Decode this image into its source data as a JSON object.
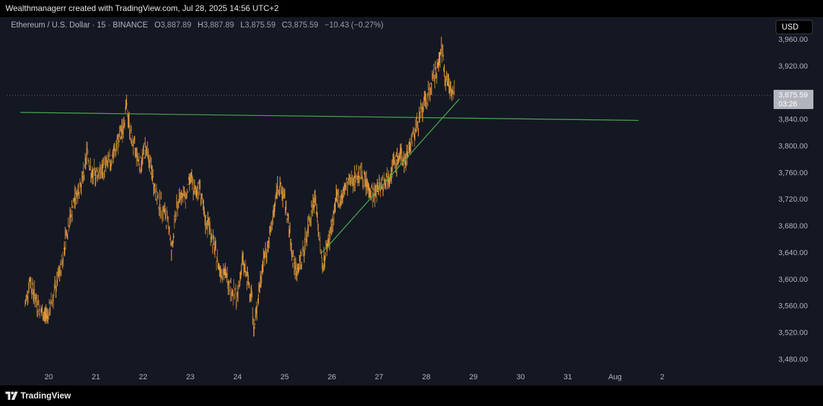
{
  "header": {
    "text": "Wealthmanagerr created with TradingView.com, Jul 28, 2025 14:56 UTC+2"
  },
  "legend": {
    "symbol": "Ethereum / U.S. Dollar · 15 · BINANCE",
    "open_label": "O",
    "open": "3,887.89",
    "high_label": "H",
    "high": "3,887.89",
    "low_label": "L",
    "low": "3,875.59",
    "close_label": "C",
    "close": "3,875.59",
    "change": "−10.43 (−0.27%)"
  },
  "currency_button": "USD",
  "price_tag": {
    "price": "3,875.59",
    "countdown": "03:26"
  },
  "footer": {
    "logo_text": "TradingView"
  },
  "colors": {
    "background": "#141823",
    "candles": "#f0a23c",
    "trendline": "#4caf50",
    "price_tag": "#b2b5be"
  },
  "chart_data": {
    "type": "line",
    "series_type": "candlestick",
    "y_axis": {
      "ticks": [
        "3,960.00",
        "3,920.00",
        "3,880.00",
        "3,840.00",
        "3,800.00",
        "3,760.00",
        "3,720.00",
        "3,680.00",
        "3,640.00",
        "3,600.00",
        "3,560.00",
        "3,520.00",
        "3,480.00"
      ],
      "range": [
        3460,
        3970
      ]
    },
    "x_axis": {
      "ticks": [
        "20",
        "21",
        "22",
        "23",
        "24",
        "25",
        "26",
        "27",
        "28",
        "29",
        "30",
        "31",
        "Aug",
        "2"
      ]
    },
    "current_price": 3875.59,
    "price_path": [
      [
        19.5,
        3560
      ],
      [
        19.6,
        3600
      ],
      [
        19.7,
        3575
      ],
      [
        19.8,
        3555
      ],
      [
        19.9,
        3545
      ],
      [
        20.0,
        3550
      ],
      [
        20.1,
        3575
      ],
      [
        20.2,
        3600
      ],
      [
        20.3,
        3630
      ],
      [
        20.35,
        3660
      ],
      [
        20.45,
        3690
      ],
      [
        20.55,
        3720
      ],
      [
        20.65,
        3740
      ],
      [
        20.75,
        3755
      ],
      [
        20.82,
        3800
      ],
      [
        20.9,
        3750
      ],
      [
        21.0,
        3760
      ],
      [
        21.1,
        3760
      ],
      [
        21.2,
        3770
      ],
      [
        21.3,
        3775
      ],
      [
        21.45,
        3800
      ],
      [
        21.55,
        3820
      ],
      [
        21.65,
        3860
      ],
      [
        21.75,
        3810
      ],
      [
        21.85,
        3790
      ],
      [
        21.95,
        3770
      ],
      [
        22.05,
        3800
      ],
      [
        22.15,
        3770
      ],
      [
        22.3,
        3720
      ],
      [
        22.45,
        3700
      ],
      [
        22.55,
        3680
      ],
      [
        22.6,
        3640
      ],
      [
        22.7,
        3700
      ],
      [
        22.8,
        3730
      ],
      [
        22.9,
        3720
      ],
      [
        23.0,
        3750
      ],
      [
        23.1,
        3730
      ],
      [
        23.2,
        3740
      ],
      [
        23.3,
        3690
      ],
      [
        23.4,
        3680
      ],
      [
        23.5,
        3650
      ],
      [
        23.6,
        3620
      ],
      [
        23.7,
        3610
      ],
      [
        23.8,
        3600
      ],
      [
        23.9,
        3580
      ],
      [
        24.0,
        3570
      ],
      [
        24.1,
        3630
      ],
      [
        24.2,
        3600
      ],
      [
        24.3,
        3580
      ],
      [
        24.35,
        3520
      ],
      [
        24.45,
        3580
      ],
      [
        24.55,
        3630
      ],
      [
        24.65,
        3650
      ],
      [
        24.75,
        3690
      ],
      [
        24.85,
        3740
      ],
      [
        24.95,
        3730
      ],
      [
        25.05,
        3700
      ],
      [
        25.15,
        3640
      ],
      [
        25.25,
        3610
      ],
      [
        25.35,
        3630
      ],
      [
        25.45,
        3660
      ],
      [
        25.55,
        3700
      ],
      [
        25.65,
        3720
      ],
      [
        25.75,
        3650
      ],
      [
        25.8,
        3620
      ],
      [
        25.9,
        3650
      ],
      [
        26.0,
        3680
      ],
      [
        26.1,
        3720
      ],
      [
        26.2,
        3720
      ],
      [
        26.3,
        3740
      ],
      [
        26.45,
        3750
      ],
      [
        26.6,
        3760
      ],
      [
        26.75,
        3740
      ],
      [
        26.9,
        3725
      ],
      [
        27.0,
        3740
      ],
      [
        27.15,
        3750
      ],
      [
        27.3,
        3770
      ],
      [
        27.45,
        3785
      ],
      [
        27.55,
        3775
      ],
      [
        27.65,
        3800
      ],
      [
        27.75,
        3820
      ],
      [
        27.85,
        3840
      ],
      [
        27.95,
        3860
      ],
      [
        28.05,
        3880
      ],
      [
        28.15,
        3900
      ],
      [
        28.25,
        3920
      ],
      [
        28.32,
        3950
      ],
      [
        28.4,
        3905
      ],
      [
        28.5,
        3890
      ],
      [
        28.6,
        3876
      ]
    ],
    "trendlines": [
      {
        "from": [
          19.4,
          3850
        ],
        "to": [
          32.5,
          3838
        ]
      },
      {
        "from": [
          25.8,
          3640
        ],
        "to": [
          28.7,
          3870
        ]
      }
    ]
  }
}
